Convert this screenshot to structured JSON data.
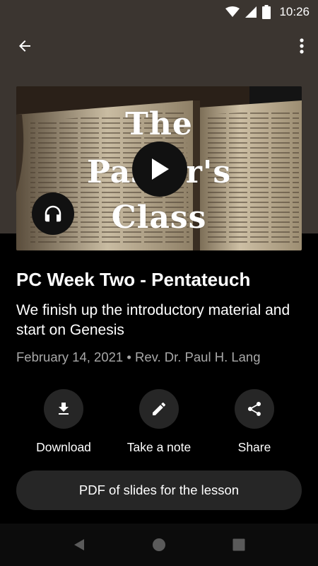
{
  "status_bar": {
    "time": "10:26"
  },
  "artwork": {
    "line1": "The",
    "line2": "Pastor's",
    "line3": "Class"
  },
  "episode": {
    "title": "PC Week Two - Pentateuch",
    "description": "We finish up the introductory material and start on Genesis",
    "date": "February 14, 2021",
    "separator": "•",
    "author": "Rev. Dr. Paul H. Lang"
  },
  "actions": {
    "download": "Download",
    "note": "Take a note",
    "share": "Share"
  },
  "attachment": {
    "label": "PDF of slides for the lesson"
  },
  "icons": [
    "wifi-icon",
    "cellular-icon",
    "battery-icon",
    "back-arrow-icon",
    "more-vert-icon",
    "play-icon",
    "headphones-icon",
    "download-icon",
    "pencil-icon",
    "share-icon",
    "nav-back-icon",
    "nav-home-icon",
    "nav-recents-icon"
  ],
  "colors": {
    "hero": "#3b3530",
    "background": "#000000",
    "surface": "#262626",
    "meta_text": "#a8a8a8"
  }
}
